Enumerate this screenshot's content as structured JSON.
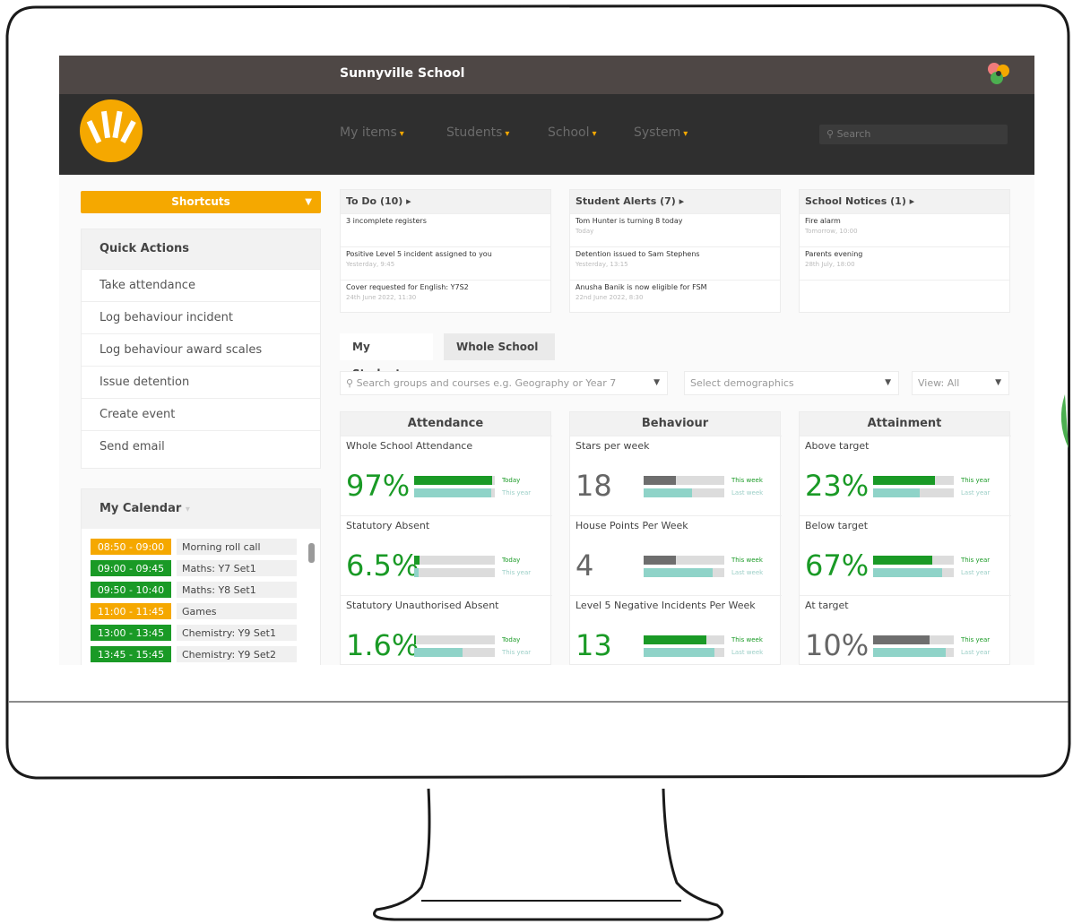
{
  "header": {
    "school_name": "Sunnyville School"
  },
  "nav": {
    "items": [
      "My items",
      "Students",
      "School",
      "System"
    ],
    "search_placeholder": "Search"
  },
  "sidebar": {
    "shortcuts_label": "Shortcuts",
    "quick_actions": {
      "title": "Quick Actions",
      "items": [
        "Take attendance",
        "Log behaviour incident",
        "Log behaviour award scales",
        "Issue detention",
        "Create event",
        "Send email"
      ]
    },
    "calendar": {
      "title": "My Calendar",
      "events": [
        {
          "time": "08:50 - 09:00",
          "label": "Morning roll call",
          "color": "#f5a800"
        },
        {
          "time": "09:00 - 09:45",
          "label": "Maths: Y7 Set1",
          "color": "#1a9a26"
        },
        {
          "time": "09:50 - 10:40",
          "label": "Maths: Y8 Set1",
          "color": "#1a9a26"
        },
        {
          "time": "11:00 - 11:45",
          "label": "Games",
          "color": "#f5a800"
        },
        {
          "time": "13:00 - 13:45",
          "label": "Chemistry: Y9 Set1",
          "color": "#1a9a26"
        },
        {
          "time": "13:45 - 15:45",
          "label": "Chemistry: Y9 Set2",
          "color": "#1a9a26"
        }
      ]
    }
  },
  "cards": {
    "todo": {
      "title": "To Do (10) ▸",
      "items": [
        {
          "text": "3 incomplete registers",
          "sub": ""
        },
        {
          "text": "Positive Level 5 incident assigned to you",
          "sub": "Yesterday, 9:45"
        },
        {
          "text": "Cover requested for English: Y7S2",
          "sub": "24th June 2022, 11:30"
        }
      ]
    },
    "alerts": {
      "title": "Student Alerts (7) ▸",
      "items": [
        {
          "text": "Tom Hunter is turning 8 today",
          "sub": "Today"
        },
        {
          "text": "Detention issued to Sam Stephens",
          "sub": "Yesterday, 13:15"
        },
        {
          "text": "Anusha Banik is now eligible for FSM",
          "sub": "22nd June 2022, 8:30"
        }
      ]
    },
    "notices": {
      "title": "School Notices (1) ▸",
      "items": [
        {
          "text": "Fire alarm",
          "sub": "Tomorrow, 10:00"
        },
        {
          "text": "Parents evening",
          "sub": "28th July, 18:00"
        },
        {
          "text": "",
          "sub": ""
        }
      ]
    }
  },
  "tabs": [
    "My Students",
    "Whole School"
  ],
  "filters": {
    "groups_placeholder": "Search groups and courses e.g. Geography or Year 7",
    "demographics_placeholder": "Select demographics",
    "view": "View: All"
  },
  "columns": {
    "attendance": {
      "title": "Attendance",
      "metrics": [
        {
          "title": "Whole School Attendance",
          "value": "97%",
          "value_color": "#1a9a26",
          "bar1": {
            "frac": 0.97,
            "color": "#1a9a26",
            "label": "Today"
          },
          "bar2": {
            "frac": 0.96,
            "color": "#8fd3c8",
            "label": "This year"
          }
        },
        {
          "title": "Statutory Absent",
          "value": "6.5%",
          "value_color": "#1a9a26",
          "bar1": {
            "frac": 0.065,
            "color": "#1a9a26",
            "label": "Today"
          },
          "bar2": {
            "frac": 0.05,
            "color": "#8fd3c8",
            "label": "This year"
          }
        },
        {
          "title": "Statutory Unauthorised Absent",
          "value": "1.6%",
          "value_color": "#1a9a26",
          "bar1": {
            "frac": 0.016,
            "color": "#1a9a26",
            "label": "Today"
          },
          "bar2": {
            "frac": 0.6,
            "color": "#8fd3c8",
            "label": "This year"
          }
        }
      ]
    },
    "behaviour": {
      "title": "Behaviour",
      "metrics": [
        {
          "title": "Stars per week",
          "value": "18",
          "value_color": "#666666",
          "bar1": {
            "frac": 0.4,
            "color": "#6e6e6e",
            "label": "This week"
          },
          "bar2": {
            "frac": 0.6,
            "color": "#8fd3c8",
            "label": "Last week"
          }
        },
        {
          "title": "House Points Per Week",
          "value": "4",
          "value_color": "#666666",
          "bar1": {
            "frac": 0.4,
            "color": "#6e6e6e",
            "label": "This week"
          },
          "bar2": {
            "frac": 0.85,
            "color": "#8fd3c8",
            "label": "Last week"
          }
        },
        {
          "title": "Level 5 Negative Incidents Per Week",
          "value": "13",
          "value_color": "#1a9a26",
          "bar1": {
            "frac": 0.78,
            "color": "#1a9a26",
            "label": "This week"
          },
          "bar2": {
            "frac": 0.88,
            "color": "#8fd3c8",
            "label": "Last week"
          }
        }
      ]
    },
    "attainment": {
      "title": "Attainment",
      "metrics": [
        {
          "title": "Above target",
          "value": "23%",
          "value_color": "#1a9a26",
          "bar1": {
            "frac": 0.77,
            "color": "#1a9a26",
            "label": "This year"
          },
          "bar2": {
            "frac": 0.58,
            "color": "#8fd3c8",
            "label": "Last year"
          }
        },
        {
          "title": "Below target",
          "value": "67%",
          "value_color": "#1a9a26",
          "bar1": {
            "frac": 0.73,
            "color": "#1a9a26",
            "label": "This year"
          },
          "bar2": {
            "frac": 0.86,
            "color": "#8fd3c8",
            "label": "Last year"
          }
        },
        {
          "title": "At target",
          "value": "10%",
          "value_color": "#666666",
          "bar1": {
            "frac": 0.7,
            "color": "#6e6e6e",
            "label": "This year"
          },
          "bar2": {
            "frac": 0.9,
            "color": "#8fd3c8",
            "label": "Last year"
          }
        }
      ]
    }
  },
  "colors": {
    "accent": "#f5a800",
    "green": "#1a9a26",
    "teal": "#8fd3c8",
    "topbar": "#4e4745",
    "navbar": "#2f2f2f"
  }
}
